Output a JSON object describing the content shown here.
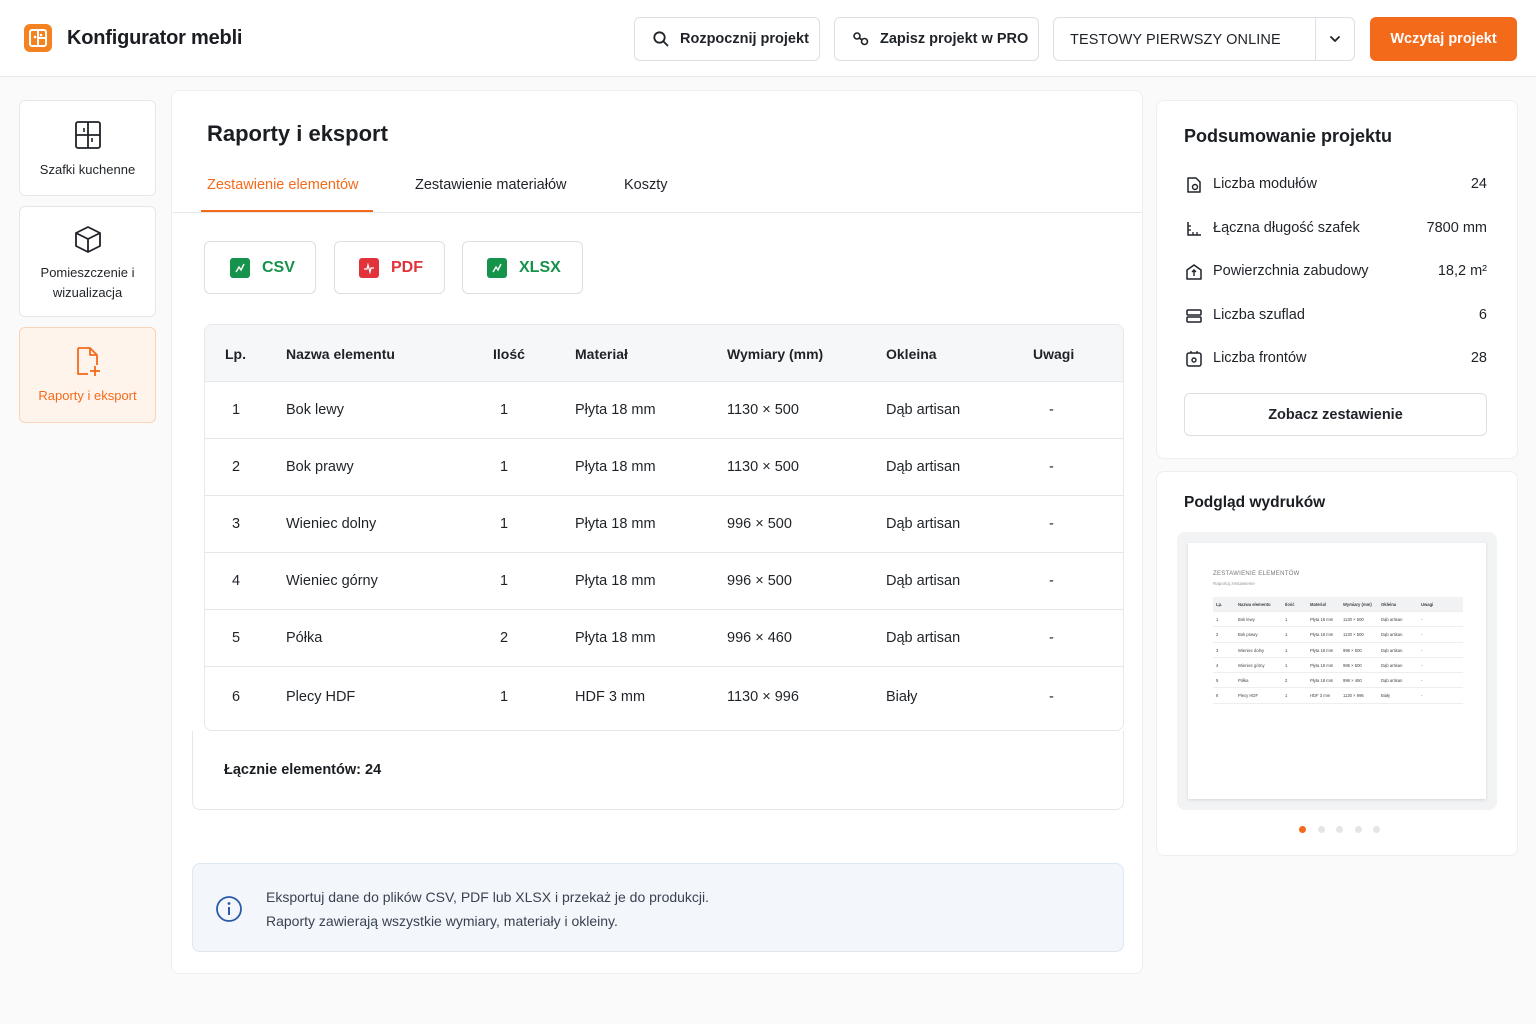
{
  "header": {
    "app_title": "Konfigurator mebli",
    "start_button": "Rozpocznij projekt",
    "save_button": "Zapisz projekt w PRO",
    "project_select": "TESTOWY PIERWSZY ONLINE",
    "load_button": "Wczytaj projekt"
  },
  "sidebar": {
    "items": [
      {
        "label": "Szafki kuchenne",
        "icon": "cabinet-icon"
      },
      {
        "label": "Pomieszczenie i wizualizacja",
        "icon": "cube-icon"
      },
      {
        "label": "Raporty i eksport",
        "icon": "file-plus-icon",
        "active": true
      }
    ]
  },
  "main": {
    "title": "Raporty i eksport",
    "tabs": [
      {
        "label": "Zestawienie elementów",
        "active": true
      },
      {
        "label": "Zestawienie materiałów"
      },
      {
        "label": "Koszty"
      }
    ],
    "export_buttons": [
      "CSV",
      "PDF",
      "XLSX"
    ],
    "table": {
      "headers": [
        "Lp.",
        "Nazwa elementu",
        "Ilość",
        "Materiał",
        "Wymiary (mm)",
        "Okleina",
        "Uwagi"
      ],
      "rows": [
        [
          "1",
          "Bok lewy",
          "1",
          "Płyta 18 mm",
          "1130 × 500",
          "Dąb artisan",
          "-"
        ],
        [
          "2",
          "Bok prawy",
          "1",
          "Płyta 18 mm",
          "1130 × 500",
          "Dąb artisan",
          "-"
        ],
        [
          "3",
          "Wieniec dolny",
          "1",
          "Płyta 18 mm",
          "996 × 500",
          "Dąb artisan",
          "-"
        ],
        [
          "4",
          "Wieniec górny",
          "1",
          "Płyta 18 mm",
          "996 × 500",
          "Dąb artisan",
          "-"
        ],
        [
          "5",
          "Półka",
          "2",
          "Płyta 18 mm",
          "996 × 460",
          "Dąb artisan",
          "-"
        ],
        [
          "6",
          "Plecy HDF",
          "1",
          "HDF 3 mm",
          "1130 × 996",
          "Biały",
          "-"
        ]
      ]
    },
    "total": "Łącznie elementów: 24",
    "info_line1": "Eksportuj dane do plików CSV, PDF lub XLSX i przekaż je do produkcji.",
    "info_line2": "Raporty zawierają wszystkie wymiary, materiały i okleiny."
  },
  "summary": {
    "title": "Podsumowanie projektu",
    "rows": [
      {
        "label": "Liczba modułów",
        "value": "24",
        "icon": "module-icon"
      },
      {
        "label": "Łączna długość szafek",
        "value": "7800 mm",
        "icon": "ruler-icon"
      },
      {
        "label": "Powierzchnia zabudowy",
        "value": "18,2 m²",
        "icon": "area-icon"
      },
      {
        "label": "Liczba szuflad",
        "value": "6",
        "icon": "drawer-icon"
      },
      {
        "label": "Liczba frontów",
        "value": "28",
        "icon": "front-icon"
      }
    ],
    "view_button": "Zobacz zestawienie"
  },
  "preview": {
    "title": "Podgląd wydruków",
    "doc_title": "ZESTAWIENIE ELEMENTÓW",
    "doc_subtitle": "Raportuj zestawienie",
    "doc_headers": [
      "Lp.",
      "Nazwa elementu",
      "Ilość",
      "Materiał",
      "Wymiary (mm)",
      "Okleina",
      "Uwagi"
    ],
    "doc_rows": [
      [
        "1",
        "Bok lewy",
        "1",
        "Płyta 18 mm",
        "1130 × 500",
        "Dąb artisan",
        "-"
      ],
      [
        "2",
        "Bok prawy",
        "1",
        "Płyta 18 mm",
        "1130 × 500",
        "Dąb artisan",
        "-"
      ],
      [
        "3",
        "Wieniec dolny",
        "1",
        "Płyta 18 mm",
        "996 × 500",
        "Dąb artisan",
        "-"
      ],
      [
        "4",
        "Wieniec górny",
        "1",
        "Płyta 18 mm",
        "996 × 500",
        "Dąb artisan",
        "-"
      ],
      [
        "5",
        "Półka",
        "2",
        "Płyta 18 mm",
        "996 × 460",
        "Dąb artisan",
        "-"
      ],
      [
        "6",
        "Plecy HDF",
        "1",
        "HDF 3 mm",
        "1130 × 996",
        "Biały",
        "-"
      ]
    ],
    "carousel_pages": 5,
    "active_page": 1
  },
  "colors": {
    "accent": "#f46a1b",
    "csv": "#16934b",
    "pdf": "#e2323a",
    "info_bg": "#f3f7fc"
  }
}
